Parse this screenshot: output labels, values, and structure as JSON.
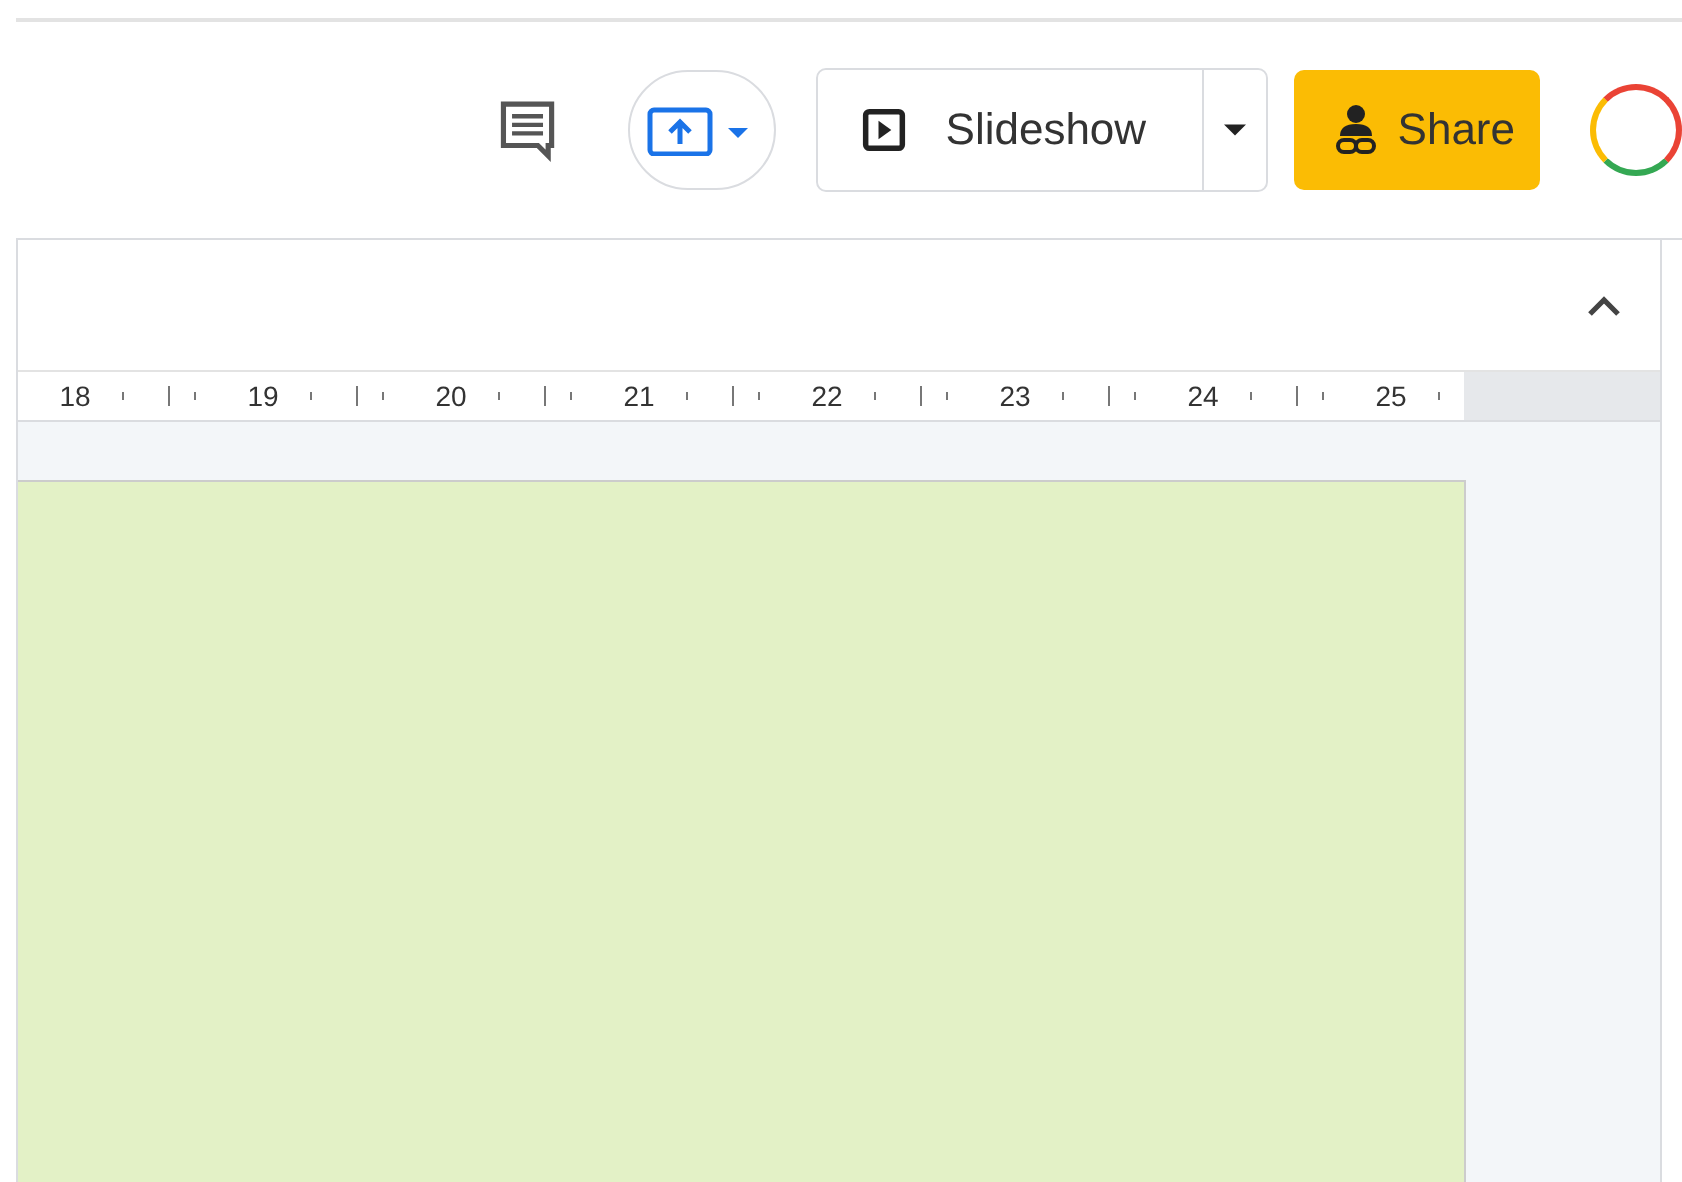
{
  "toolbar": {
    "slideshow": "Slideshow",
    "share": "Share"
  },
  "ruler": {
    "labels": [
      "18",
      "19",
      "20",
      "21",
      "22",
      "23",
      "24",
      "25"
    ]
  }
}
